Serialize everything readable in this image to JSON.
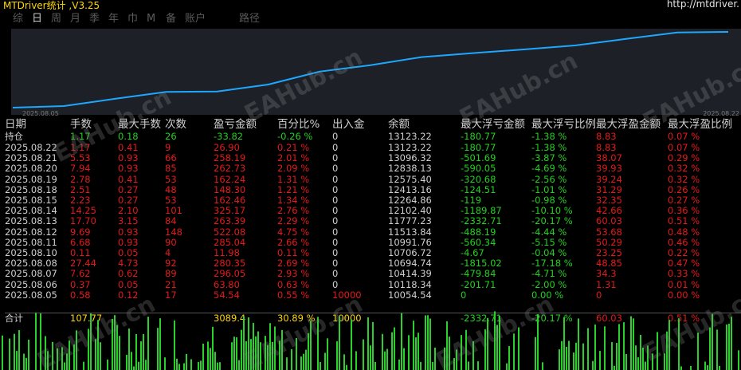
{
  "app": {
    "title": "MTDriver统计 ,V3.25",
    "url": "http://mtdriver."
  },
  "tabs": [
    {
      "label": "综",
      "active": false
    },
    {
      "label": "日",
      "active": true
    },
    {
      "label": "周",
      "active": false
    },
    {
      "label": "月",
      "active": false
    },
    {
      "label": "季",
      "active": false
    },
    {
      "label": "年",
      "active": false
    },
    {
      "label": "巾",
      "active": false
    },
    {
      "label": "M",
      "active": false
    },
    {
      "label": "备",
      "active": false
    },
    {
      "label": "账户",
      "active": false
    },
    {
      "label": "路径",
      "active": false
    }
  ],
  "equity_chart": {
    "start_date": "2025.08.05",
    "end_date": "2025.08.22",
    "line_color": "#1ea7ff",
    "balance_series": [
      10054.54,
      10118.34,
      10414.39,
      10694.74,
      10706.72,
      10991.76,
      11513.84,
      11777.23,
      12102.4,
      12264.86,
      12413.16,
      12575.4,
      12838.13,
      13096.32,
      13123.22
    ]
  },
  "table": {
    "headers": [
      "日期",
      "手数",
      "最大手数",
      "次数",
      "盈亏金额",
      "百分比%",
      "出入金",
      "余额",
      "最大浮亏金额",
      "最大浮亏比例",
      "最大浮盈金额",
      "最大浮盈比例"
    ],
    "open_row": {
      "date": "持仓",
      "lots": "1.17",
      "max_lots": "0.18",
      "count": "26",
      "pnl": "-33.82",
      "pct": "-0.26 %",
      "io": "0",
      "balance": "13123.22",
      "max_float_loss": "-180.77",
      "max_float_loss_pct": "-1.38 %",
      "max_float_profit": "8.83",
      "max_float_profit_pct": "0.07 %"
    },
    "rows": [
      {
        "date": "2025.08.22",
        "lots": "1.17",
        "max_lots": "0.41",
        "count": "9",
        "pnl": "26.90",
        "pct": "0.21 %",
        "io": "0",
        "balance": "13123.22",
        "max_float_loss": "-180.77",
        "max_float_loss_pct": "-1.38 %",
        "max_float_profit": "8.83",
        "max_float_profit_pct": "0.07 %"
      },
      {
        "date": "2025.08.21",
        "lots": "5.53",
        "max_lots": "0.93",
        "count": "66",
        "pnl": "258.19",
        "pct": "2.01 %",
        "io": "0",
        "balance": "13096.32",
        "max_float_loss": "-501.69",
        "max_float_loss_pct": "-3.87 %",
        "max_float_profit": "38.07",
        "max_float_profit_pct": "0.29 %"
      },
      {
        "date": "2025.08.20",
        "lots": "7.94",
        "max_lots": "0.93",
        "count": "85",
        "pnl": "262.73",
        "pct": "2.09 %",
        "io": "0",
        "balance": "12838.13",
        "max_float_loss": "-590.05",
        "max_float_loss_pct": "-4.69 %",
        "max_float_profit": "39.93",
        "max_float_profit_pct": "0.32 %"
      },
      {
        "date": "2025.08.19",
        "lots": "2.78",
        "max_lots": "0.41",
        "count": "53",
        "pnl": "162.24",
        "pct": "1.31 %",
        "io": "0",
        "balance": "12575.40",
        "max_float_loss": "-320.68",
        "max_float_loss_pct": "-2.56 %",
        "max_float_profit": "39.24",
        "max_float_profit_pct": "0.32 %"
      },
      {
        "date": "2025.08.18",
        "lots": "2.51",
        "max_lots": "0.27",
        "count": "48",
        "pnl": "148.30",
        "pct": "1.21 %",
        "io": "0",
        "balance": "12413.16",
        "max_float_loss": "-124.51",
        "max_float_loss_pct": "-1.01 %",
        "max_float_profit": "31.29",
        "max_float_profit_pct": "0.26 %"
      },
      {
        "date": "2025.08.15",
        "lots": "2.23",
        "max_lots": "0.27",
        "count": "53",
        "pnl": "162.46",
        "pct": "1.34 %",
        "io": "0",
        "balance": "12264.86",
        "max_float_loss": "-119",
        "max_float_loss_pct": "-0.98 %",
        "max_float_profit": "32.35",
        "max_float_profit_pct": "0.27 %"
      },
      {
        "date": "2025.08.14",
        "lots": "14.25",
        "max_lots": "2.10",
        "count": "101",
        "pnl": "325.17",
        "pct": "2.76 %",
        "io": "0",
        "balance": "12102.40",
        "max_float_loss": "-1189.87",
        "max_float_loss_pct": "-10.10 %",
        "max_float_profit": "42.66",
        "max_float_profit_pct": "0.36 %"
      },
      {
        "date": "2025.08.13",
        "lots": "17.70",
        "max_lots": "3.15",
        "count": "84",
        "pnl": "263.39",
        "pct": "2.29 %",
        "io": "0",
        "balance": "11777.23",
        "max_float_loss": "-2332.71",
        "max_float_loss_pct": "-20.17 %",
        "max_float_profit": "60.03",
        "max_float_profit_pct": "0.51 %"
      },
      {
        "date": "2025.08.12",
        "lots": "9.69",
        "max_lots": "0.93",
        "count": "148",
        "pnl": "522.08",
        "pct": "4.75 %",
        "io": "0",
        "balance": "11513.84",
        "max_float_loss": "-488.19",
        "max_float_loss_pct": "-4.44 %",
        "max_float_profit": "53.68",
        "max_float_profit_pct": "0.48 %"
      },
      {
        "date": "2025.08.11",
        "lots": "6.68",
        "max_lots": "0.93",
        "count": "90",
        "pnl": "285.04",
        "pct": "2.66 %",
        "io": "0",
        "balance": "10991.76",
        "max_float_loss": "-560.34",
        "max_float_loss_pct": "-5.15 %",
        "max_float_profit": "50.29",
        "max_float_profit_pct": "0.46 %"
      },
      {
        "date": "2025.08.10",
        "lots": "0.11",
        "max_lots": "0.05",
        "count": "4",
        "pnl": "11.98",
        "pct": "0.11 %",
        "io": "0",
        "balance": "10706.72",
        "max_float_loss": "-4.67",
        "max_float_loss_pct": "-0.04 %",
        "max_float_profit": "23.25",
        "max_float_profit_pct": "0.22 %"
      },
      {
        "date": "2025.08.08",
        "lots": "27.44",
        "max_lots": "4.73",
        "count": "92",
        "pnl": "280.35",
        "pct": "2.69 %",
        "io": "0",
        "balance": "10694.74",
        "max_float_loss": "-1815.02",
        "max_float_loss_pct": "-17.18 %",
        "max_float_profit": "48.85",
        "max_float_profit_pct": "0.47 %"
      },
      {
        "date": "2025.08.07",
        "lots": "7.62",
        "max_lots": "0.62",
        "count": "89",
        "pnl": "296.05",
        "pct": "2.93 %",
        "io": "0",
        "balance": "10414.39",
        "max_float_loss": "-479.84",
        "max_float_loss_pct": "-4.71 %",
        "max_float_profit": "34.3",
        "max_float_profit_pct": "0.33 %"
      },
      {
        "date": "2025.08.06",
        "lots": "0.37",
        "max_lots": "0.05",
        "count": "21",
        "pnl": "63.80",
        "pct": "0.63 %",
        "io": "0",
        "balance": "10118.34",
        "max_float_loss": "-201.71",
        "max_float_loss_pct": "-2.00 %",
        "max_float_profit": "1.31",
        "max_float_profit_pct": "0.01 %"
      },
      {
        "date": "2025.08.05",
        "lots": "0.58",
        "max_lots": "0.12",
        "count": "17",
        "pnl": "54.54",
        "pct": "0.55 %",
        "io": "10000",
        "balance": "10054.54",
        "max_float_loss": "0",
        "max_float_loss_pct": "0.00 %",
        "max_float_profit": "0",
        "max_float_profit_pct": "0.00 %"
      }
    ],
    "total_row": {
      "date": "合计",
      "lots": "107.77",
      "pnl": "3089.4",
      "pct": "30.89 %",
      "io": "10000",
      "max_float_loss": "-2332.71",
      "max_float_loss_pct": "-20.17 %",
      "max_float_profit": "60.03",
      "max_float_profit_pct": "0.51 %"
    }
  },
  "watermark": "EAHub.cn"
}
